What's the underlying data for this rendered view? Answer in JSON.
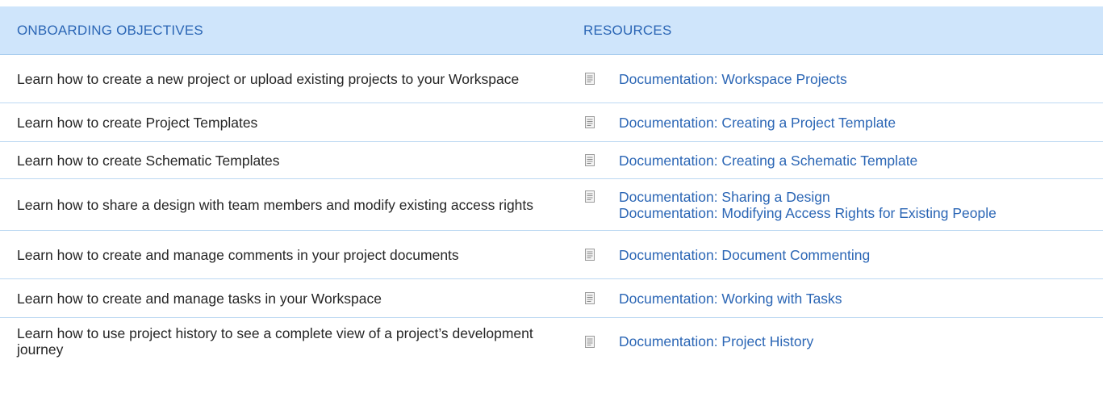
{
  "header": {
    "objectives_label": "ONBOARDING OBJECTIVES",
    "resources_label": "RESOURCES"
  },
  "rows": [
    {
      "objective": "Learn how to create a new project or upload existing projects to your Workspace",
      "links": [
        "Documentation: Workspace Projects"
      ]
    },
    {
      "objective": "Learn how to create Project Templates",
      "links": [
        "Documentation: Creating a Project Template"
      ]
    },
    {
      "objective": "Learn how to create Schematic Templates",
      "links": [
        "Documentation: Creating a Schematic Template"
      ]
    },
    {
      "objective": "Learn how to share a design with team members and modify existing access rights",
      "links": [
        "Documentation: Sharing a Design",
        "Documentation: Modifying Access Rights for Existing People"
      ]
    },
    {
      "objective": "Learn how to create and manage comments in your project documents",
      "links": [
        "Documentation: Document Commenting"
      ]
    },
    {
      "objective": "Learn how to create and manage tasks in your Workspace",
      "links": [
        "Documentation: Working with Tasks"
      ]
    },
    {
      "objective": "Learn how to use project history to see a complete view of a project’s development journey",
      "links": [
        "Documentation: Project History"
      ]
    }
  ],
  "colors": {
    "header_bg": "#cfe5fb",
    "header_text": "#2b66b5",
    "link": "#2b66b5",
    "divider": "#bcd8f2"
  },
  "icons": {
    "resource_icon": "document-icon"
  }
}
